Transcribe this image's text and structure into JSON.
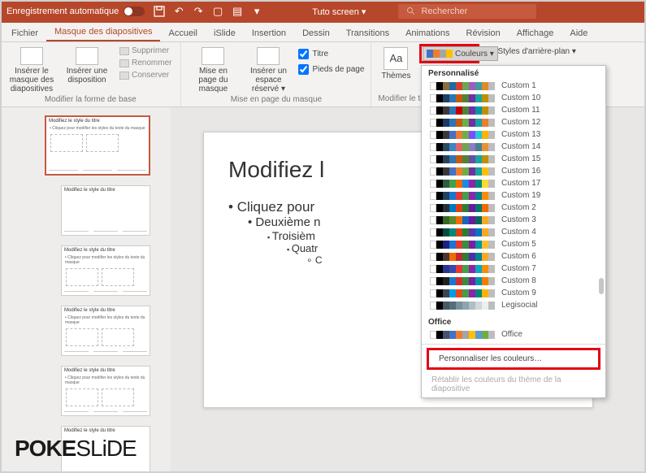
{
  "titlebar": {
    "autosave_label": "Enregistrement automatique",
    "doc_title": "Tuto screen ▾",
    "search_placeholder": "Rechercher"
  },
  "tabs": [
    "Fichier",
    "Masque des diapositives",
    "Accueil",
    "iSlide",
    "Insertion",
    "Dessin",
    "Transitions",
    "Animations",
    "Révision",
    "Affichage",
    "Aide"
  ],
  "active_tab_index": 1,
  "ribbon": {
    "group1": {
      "insert_master": "Insérer le masque des diapositives",
      "insert_layout": "Insérer une disposition",
      "delete": "Supprimer",
      "rename": "Renommer",
      "keep": "Conserver",
      "label": "Modifier la forme de base"
    },
    "group2": {
      "page_setup": "Mise en page du masque",
      "insert_ph": "Insérer un espace réservé ▾",
      "title_cb": "Titre",
      "footer_cb": "Pieds de page",
      "label": "Mise en page du masque"
    },
    "group3": {
      "themes": "Thèmes",
      "label": "Modifier le thème"
    },
    "group4": {
      "colors": "Couleurs ▾",
      "bg_styles": "Styles d'arrière-plan ▾"
    }
  },
  "thumbs": {
    "title": "Modifiez le style du titre",
    "body_hint": "Cliquez pour modifier les styles du texte du masque"
  },
  "slide": {
    "title": "Modifiez l",
    "b1": "Cliquez pour ",
    "b2": "Deuxième n",
    "b3": "Troisièm",
    "b4": "Quatr",
    "b5": "C"
  },
  "dropdown": {
    "section1": "Personnalisé",
    "section2": "Office",
    "custom_items": [
      {
        "name": "Custom 1",
        "c": [
          "#ffffff",
          "#000000",
          "#8a6d3b",
          "#1f6aa5",
          "#d73f2a",
          "#6aa84f",
          "#a25bc3",
          "#409da0",
          "#e08a2c",
          "#bdbdbd"
        ]
      },
      {
        "name": "Custom 10",
        "c": [
          "#ffffff",
          "#000000",
          "#1e415e",
          "#2e75b6",
          "#c55a11",
          "#548235",
          "#7030a0",
          "#1aa3a3",
          "#bf9000",
          "#bdbdbd"
        ]
      },
      {
        "name": "Custom 11",
        "c": [
          "#ffffff",
          "#000000",
          "#3b3838",
          "#2e75b6",
          "#c00000",
          "#548235",
          "#7030a0",
          "#0097a7",
          "#bf9000",
          "#bdbdbd"
        ]
      },
      {
        "name": "Custom 12",
        "c": [
          "#ffffff",
          "#000000",
          "#1f3864",
          "#2e75b6",
          "#c55a11",
          "#70ad47",
          "#7030a0",
          "#1aa3a3",
          "#ed7d31",
          "#bdbdbd"
        ]
      },
      {
        "name": "Custom 13",
        "c": [
          "#ffffff",
          "#000000",
          "#3b3838",
          "#4472c4",
          "#ed7d31",
          "#70ad47",
          "#7c4dff",
          "#26c6da",
          "#ffb300",
          "#bdbdbd"
        ]
      },
      {
        "name": "Custom 14",
        "c": [
          "#ffffff",
          "#000000",
          "#2b4a5f",
          "#3d85c6",
          "#e06666",
          "#6aa84f",
          "#8e7cc3",
          "#45818e",
          "#e69138",
          "#bdbdbd"
        ]
      },
      {
        "name": "Custom 15",
        "c": [
          "#ffffff",
          "#000000",
          "#294257",
          "#2e75b6",
          "#c55a11",
          "#548235",
          "#674ea7",
          "#1aa3a3",
          "#bf9000",
          "#bdbdbd"
        ]
      },
      {
        "name": "Custom 16",
        "c": [
          "#ffffff",
          "#000000",
          "#3b3838",
          "#4472c4",
          "#ed7d31",
          "#70ad47",
          "#7030a0",
          "#1aa3a3",
          "#ffc000",
          "#bdbdbd"
        ]
      },
      {
        "name": "Custom 17",
        "c": [
          "#ffffff",
          "#000000",
          "#2e5c3e",
          "#43a047",
          "#ef6c00",
          "#1e88e5",
          "#8e24aa",
          "#00897b",
          "#fdd835",
          "#bdbdbd"
        ]
      },
      {
        "name": "Custom 19",
        "c": [
          "#ffffff",
          "#000000",
          "#1e415e",
          "#1976d2",
          "#e53935",
          "#43a047",
          "#8e24aa",
          "#00838f",
          "#fb8c00",
          "#bdbdbd"
        ]
      },
      {
        "name": "Custom 2",
        "c": [
          "#ffffff",
          "#000000",
          "#263238",
          "#0277bd",
          "#d84315",
          "#2e7d32",
          "#6a1b9a",
          "#00796b",
          "#ef6c00",
          "#bdbdbd"
        ]
      },
      {
        "name": "Custom 3",
        "c": [
          "#ffffff",
          "#000000",
          "#33691e",
          "#558b2f",
          "#ef6c00",
          "#1565c0",
          "#6a1b9a",
          "#00695c",
          "#f9a825",
          "#bdbdbd"
        ]
      },
      {
        "name": "Custom 4",
        "c": [
          "#ffffff",
          "#000000",
          "#004d40",
          "#00897b",
          "#d84315",
          "#2e7d32",
          "#5e35b1",
          "#0277bd",
          "#f9a825",
          "#bdbdbd"
        ]
      },
      {
        "name": "Custom 5",
        "c": [
          "#ffffff",
          "#000000",
          "#1a237e",
          "#1976d2",
          "#e53935",
          "#388e3c",
          "#7b1fa2",
          "#0097a7",
          "#fbc02d",
          "#bdbdbd"
        ]
      },
      {
        "name": "Custom 6",
        "c": [
          "#ffffff",
          "#000000",
          "#4e342e",
          "#ef6c00",
          "#c62828",
          "#2e7d32",
          "#512da8",
          "#00838f",
          "#f9a825",
          "#bdbdbd"
        ]
      },
      {
        "name": "Custom 7",
        "c": [
          "#ffffff",
          "#000000",
          "#283593",
          "#3949ab",
          "#e53935",
          "#43a047",
          "#8e24aa",
          "#00acc1",
          "#fb8c00",
          "#bdbdbd"
        ]
      },
      {
        "name": "Custom 8",
        "c": [
          "#ffffff",
          "#000000",
          "#212121",
          "#1976d2",
          "#d32f2f",
          "#388e3c",
          "#7b1fa2",
          "#0097a7",
          "#f57c00",
          "#bdbdbd"
        ]
      },
      {
        "name": "Custom 9",
        "c": [
          "#ffffff",
          "#000000",
          "#37474f",
          "#039be5",
          "#e64a19",
          "#43a047",
          "#8e24aa",
          "#00897b",
          "#ffb300",
          "#bdbdbd"
        ]
      },
      {
        "name": "Legisocial",
        "c": [
          "#ffffff",
          "#000000",
          "#455a64",
          "#546e7a",
          "#78909c",
          "#90a4ae",
          "#b0bec5",
          "#cfd8dc",
          "#eceff1",
          "#bdbdbd"
        ]
      }
    ],
    "office_item": {
      "name": "Office",
      "c": [
        "#ffffff",
        "#000000",
        "#44546a",
        "#4472c4",
        "#ed7d31",
        "#a5a5a5",
        "#ffc000",
        "#5b9bd5",
        "#70ad47",
        "#bdbdbd"
      ]
    },
    "customize": "Personnaliser les couleurs…",
    "reset": "Rétablir les couleurs du thème de la diapositive"
  },
  "watermark": {
    "a": "POKE",
    "b": "SLiDE"
  }
}
